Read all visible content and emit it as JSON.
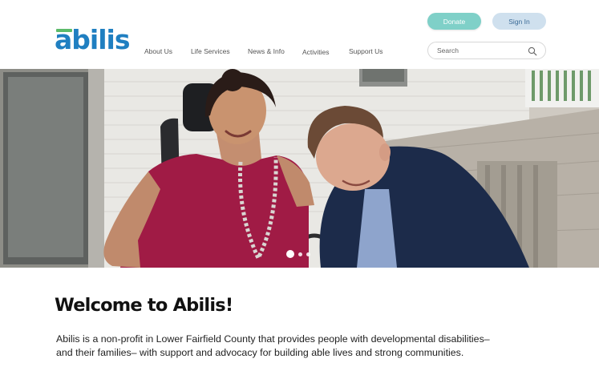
{
  "brand": {
    "name": "abilis",
    "accent": "#1f7fc1",
    "logo_bar_color": "#5cbb6a"
  },
  "nav": {
    "items": [
      "About Us",
      "Life Services",
      "News & Info",
      "Activities",
      "Support Us"
    ]
  },
  "header_actions": {
    "donate_label": "Donate",
    "donate_color": "#7fd0c8",
    "signin_label": "Sign In",
    "signin_color": "#cfe0ee"
  },
  "search": {
    "placeholder": "Search",
    "value": "",
    "icon": "search-icon"
  },
  "hero": {
    "image_description": "",
    "carousel": {
      "slide_count": 3,
      "active_index": 0
    }
  },
  "welcome": {
    "title": "Welcome to Abilis!",
    "body_line1": "Abilis is a non-profit in Lower Fairfield County that provides people with developmental disabilities–",
    "body_line2": "and their families– with support and advocacy for building able lives and strong communities."
  }
}
